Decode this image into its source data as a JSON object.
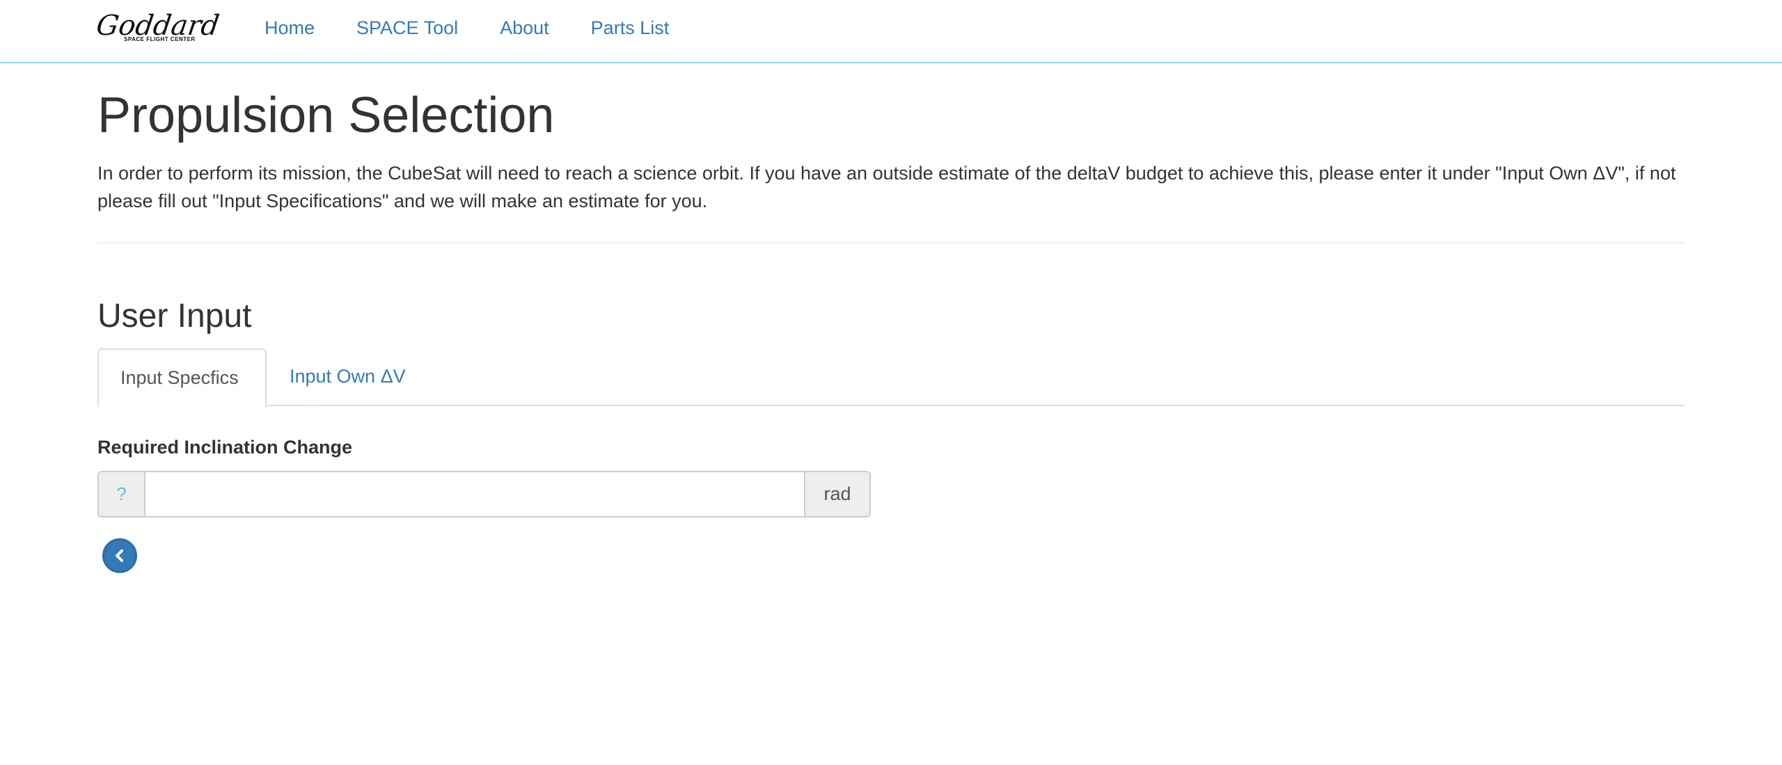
{
  "navbar": {
    "logo_text": "Goddard",
    "logo_subtext": "SPACE FLIGHT CENTER",
    "links": [
      "Home",
      "SPACE Tool",
      "About",
      "Parts List"
    ]
  },
  "page": {
    "title": "Propulsion Selection",
    "intro": "In order to perform its mission, the CubeSat will need to reach a science orbit. If you have an outside estimate of the deltaV budget to achieve this, please enter it under \"Input Own ΔV\", if not please fill out \"Input Specifications\" and we will make an estimate for you."
  },
  "user_input": {
    "heading": "User Input",
    "tabs": [
      {
        "label": "Input Specfics",
        "active": true
      },
      {
        "label": "Input Own ΔV",
        "active": false
      }
    ],
    "field": {
      "label": "Required Inclination Change",
      "help": "?",
      "value": "",
      "unit": "rad"
    }
  },
  "colors": {
    "link": "#337ab7",
    "help_icon": "#5bc0de",
    "navbar_border": "#8fd1e6"
  },
  "icons": {
    "back": "chevron-left-circle-icon",
    "help": "question-icon"
  }
}
